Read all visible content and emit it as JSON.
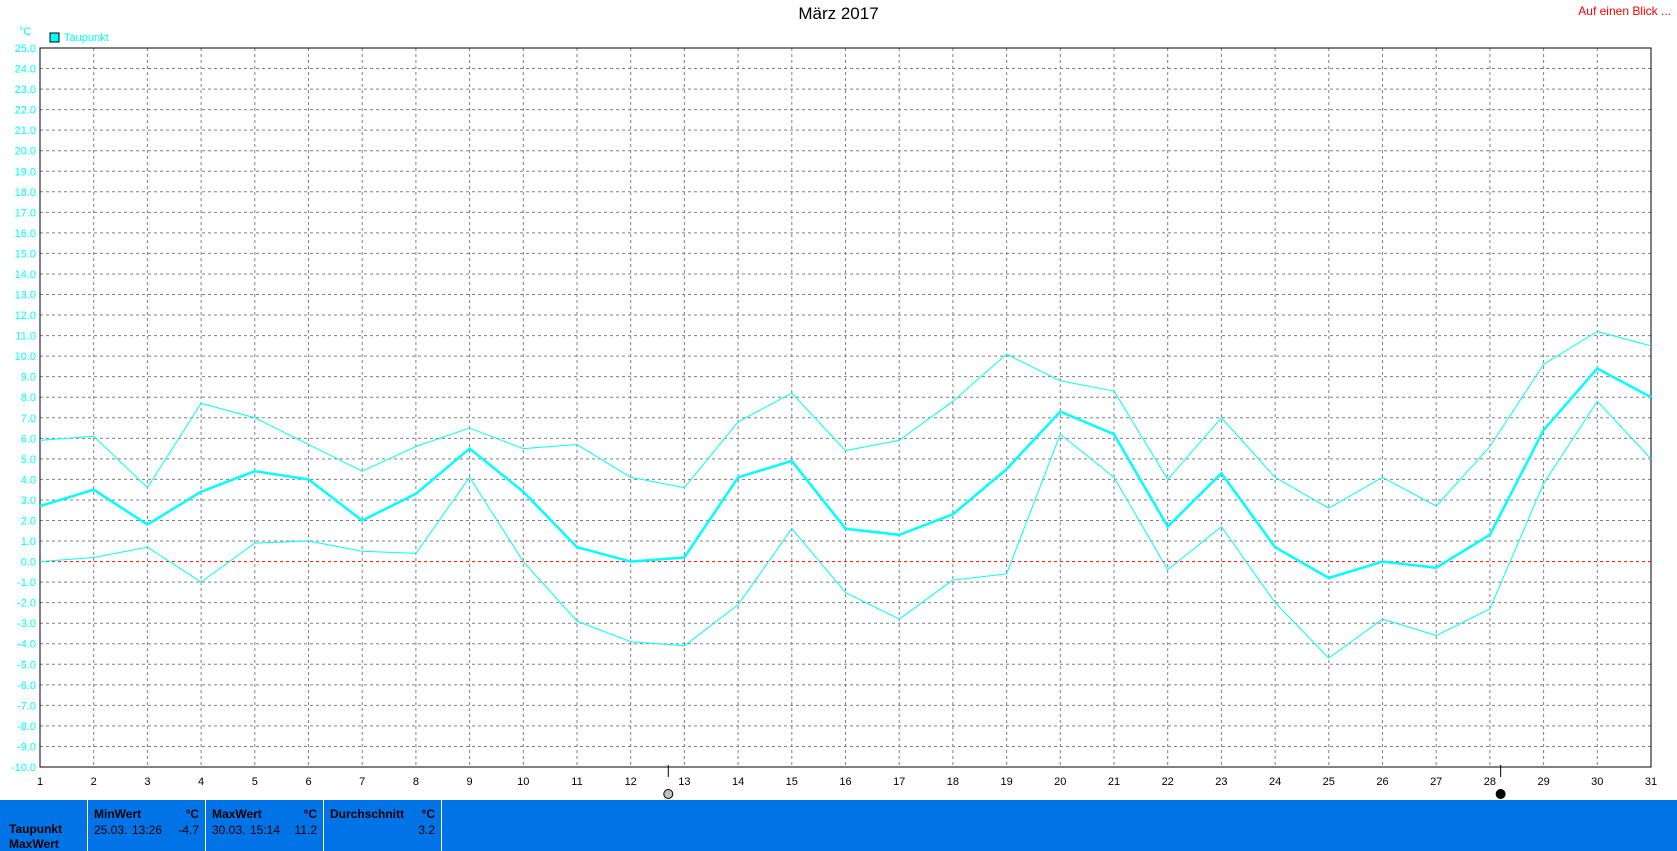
{
  "title": "März 2017",
  "glance_link": "Auf einen Blick ...",
  "chart_data": {
    "type": "line",
    "title": "März 2017",
    "unit_label": "°C",
    "legend": [
      "Taupunkt"
    ],
    "legend_color": "#00ffff",
    "x": [
      1,
      2,
      3,
      4,
      5,
      6,
      7,
      8,
      9,
      10,
      11,
      12,
      13,
      14,
      15,
      16,
      17,
      18,
      19,
      20,
      21,
      22,
      23,
      24,
      25,
      26,
      27,
      28,
      29,
      30,
      31
    ],
    "xlim": [
      1,
      31
    ],
    "ylim": [
      -10,
      25
    ],
    "y_ticks": [
      "25.0",
      "24.0",
      "23.0",
      "22.0",
      "21.0",
      "20.0",
      "19.0",
      "18.0",
      "17.0",
      "16.0",
      "15.0",
      "14.0",
      "13.0",
      "12.0",
      "11.0",
      "10.0",
      "9.0",
      "8.0",
      "7.0",
      "6.0",
      "5.0",
      "4.0",
      "3.0",
      "2.0",
      "1.0",
      "0.0",
      "-1.0",
      "-2.0",
      "-3.0",
      "-4.0",
      "-5.0",
      "-6.0",
      "-7.0",
      "-8.0",
      "-9.0",
      "-10.0"
    ],
    "x_ticks": [
      "1",
      "2",
      "3",
      "4",
      "5",
      "6",
      "7",
      "8",
      "9",
      "10",
      "11",
      "12",
      "13",
      "14",
      "15",
      "16",
      "17",
      "18",
      "19",
      "20",
      "21",
      "22",
      "23",
      "24",
      "25",
      "26",
      "27",
      "28",
      "29",
      "30",
      "31"
    ],
    "grid": true,
    "zero_line_color": "#ff0000",
    "series": [
      {
        "role": "max",
        "values": [
          5.9,
          6.1,
          3.6,
          7.7,
          7.0,
          5.7,
          4.4,
          5.6,
          6.5,
          5.5,
          5.7,
          4.1,
          3.6,
          6.8,
          8.2,
          5.4,
          5.9,
          7.8,
          10.1,
          8.8,
          8.3,
          4.0,
          7.0,
          4.1,
          2.6,
          4.1,
          2.7,
          5.6,
          9.6,
          11.2,
          10.5
        ],
        "color": "#00ffff",
        "width": 1
      },
      {
        "role": "avg",
        "values": [
          2.7,
          3.5,
          1.8,
          3.4,
          4.4,
          4.0,
          2.0,
          3.3,
          5.5,
          3.4,
          0.7,
          0.0,
          0.2,
          4.1,
          4.9,
          1.6,
          1.3,
          2.3,
          4.5,
          7.3,
          6.2,
          1.7,
          4.3,
          0.7,
          -0.8,
          0.0,
          -0.3,
          1.3,
          6.4,
          9.4,
          8.0
        ],
        "color": "#00ffff",
        "width": 2.5
      },
      {
        "role": "min",
        "values": [
          0.0,
          0.2,
          0.7,
          -1.0,
          0.9,
          1.0,
          0.5,
          0.4,
          4.1,
          0.0,
          -2.9,
          -3.9,
          -4.1,
          -2.1,
          1.6,
          -1.5,
          -2.8,
          -0.9,
          -0.6,
          6.2,
          4.1,
          -0.4,
          1.7,
          -2.0,
          -4.7,
          -2.8,
          -3.6,
          -2.3,
          3.8,
          7.8,
          5.0
        ],
        "color": "#00ffff",
        "width": 1
      }
    ],
    "moon_phases": [
      {
        "x": 12.7,
        "phase": "full"
      },
      {
        "x": 28.2,
        "phase": "new"
      }
    ]
  },
  "stats": {
    "row_label": "Taupunkt",
    "row_label_2": "MaxWert",
    "min_header": "MinWert",
    "max_header": "MaxWert",
    "avg_header": "Durchschnitt",
    "unit": "°C",
    "min_date": "25.03.",
    "min_time": "13:26",
    "min_value": "-4.7",
    "max_date": "30.03.",
    "max_time": "15:14",
    "max_value": "11.2",
    "avg_value": "3.2"
  }
}
